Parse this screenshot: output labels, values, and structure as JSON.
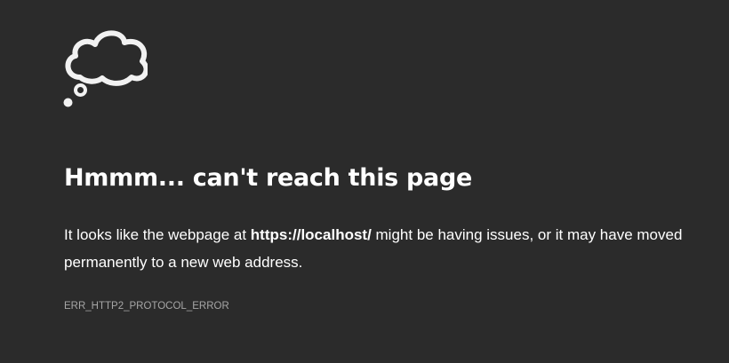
{
  "page": {
    "icon": "thought-cloud-icon",
    "title": "Hmmm... can't reach this page",
    "message_before_url": "It looks like the webpage at ",
    "url": "https://localhost/",
    "message_after_url": " might be having issues, or it may have moved permanently to a new web address.",
    "error_code": "ERR_HTTP2_PROTOCOL_ERROR"
  },
  "colors": {
    "background": "#2b2b2b",
    "text": "#ffffff",
    "muted_text": "#a6a6a6",
    "icon_stroke": "#f2f2f2"
  }
}
